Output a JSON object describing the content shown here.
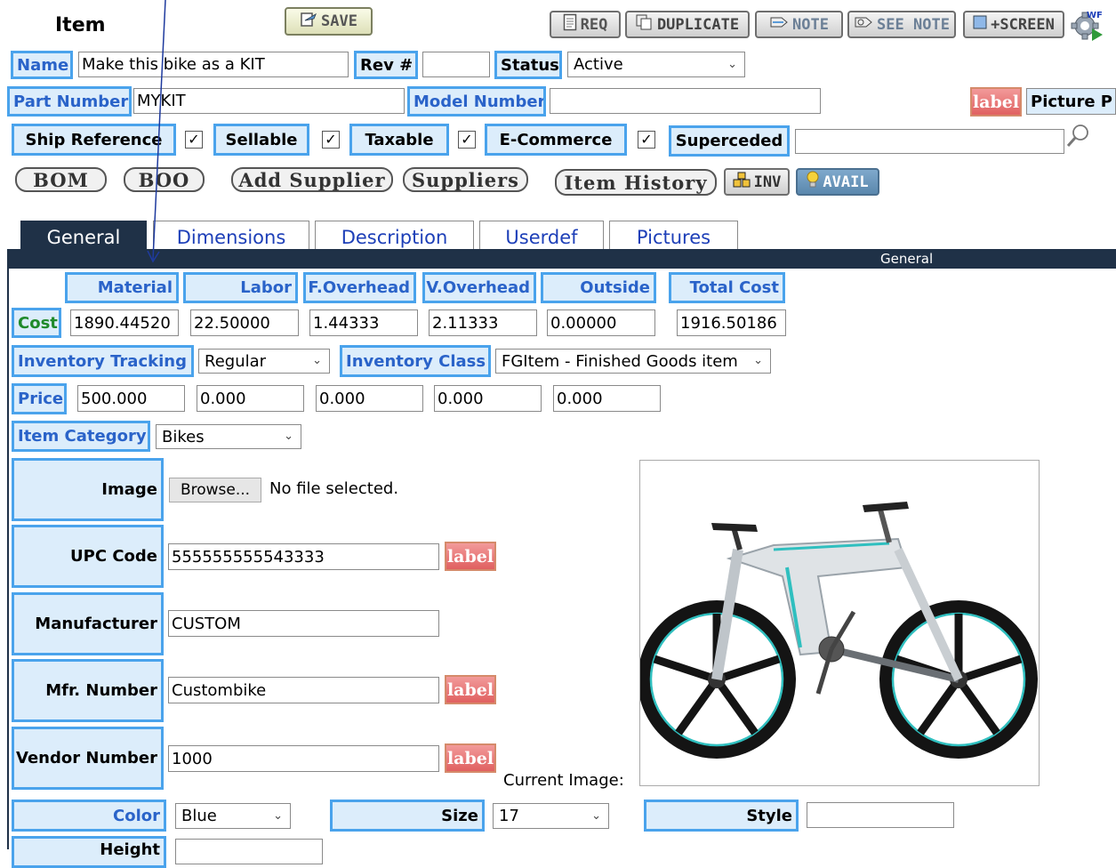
{
  "header": {
    "title": "Item",
    "save_label": "SAVE",
    "req_label": "REQ",
    "duplicate_label": "DUPLICATE",
    "note_label": "NOTE",
    "see_note_label": "SEE NOTE",
    "screen_label": "+SCREEN",
    "wf_label": "WF"
  },
  "fields": {
    "name_label": "Name",
    "name_value": "Make this bike as a KIT",
    "rev_label": "Rev #",
    "rev_value": "",
    "status_label": "Status",
    "status_value": "Active",
    "part_number_label": "Part Number",
    "part_number_value": "MYKIT",
    "model_number_label": "Model Number",
    "model_number_value": "",
    "label_badge": "label",
    "picture_label": "Picture P",
    "ship_reference_label": "Ship Reference",
    "sellable_label": "Sellable",
    "taxable_label": "Taxable",
    "ecommerce_label": "E-Commerce",
    "superceded_label": "Superceded",
    "superceded_value": "",
    "checkmark": "✓"
  },
  "buttons": {
    "bom": "BOM",
    "boo": "BOO",
    "add_supplier": "Add Supplier",
    "suppliers": "Suppliers",
    "item_history": "Item History",
    "inv": "INV",
    "avail": "AVAIL"
  },
  "tabs": [
    {
      "label": "General"
    },
    {
      "label": "Dimensions"
    },
    {
      "label": "Description"
    },
    {
      "label": "Userdef"
    },
    {
      "label": "Pictures"
    }
  ],
  "section_title": "General",
  "cost": {
    "headers": [
      "Material",
      "Labor",
      "F.Overhead",
      "V.Overhead",
      "Outside",
      "Total Cost"
    ],
    "row_label": "Cost",
    "values": [
      "1890.44520",
      "22.50000",
      "1.44333",
      "2.11333",
      "0.00000",
      "1916.50186"
    ]
  },
  "inventory": {
    "tracking_label": "Inventory Tracking",
    "tracking_value": "Regular",
    "class_label": "Inventory Class",
    "class_value": "FGItem - Finished Goods item"
  },
  "price": {
    "label": "Price",
    "values": [
      "500.000",
      "0.000",
      "0.000",
      "0.000",
      "0.000"
    ]
  },
  "category": {
    "label": "Item Category",
    "value": "Bikes"
  },
  "details": {
    "image_label": "Image",
    "browse_label": "Browse...",
    "no_file": "No file selected.",
    "upc_label": "UPC Code",
    "upc_value": "555555555543333",
    "manufacturer_label": "Manufacturer",
    "manufacturer_value": "CUSTOM",
    "mfr_number_label": "Mfr. Number",
    "mfr_number_value": "Custombike",
    "vendor_number_label": "Vendor Number",
    "vendor_number_value": "1000",
    "current_image_label": "Current Image:",
    "color_label": "Color",
    "color_value": "Blue",
    "size_label": "Size",
    "size_value": "17",
    "style_label": "Style",
    "style_value": "",
    "height_label": "Height"
  },
  "colors": {
    "label_border": "#4aa3ec",
    "label_bg": "#dcedfb",
    "tab_active_bg": "#1f3147",
    "section_bar": "#1f3147",
    "badge_red": "#e06060"
  },
  "icons": {
    "save": "save-icon",
    "req": "document-icon",
    "duplicate": "duplicate-icon",
    "note": "note-icon",
    "see_note": "see-note-icon",
    "screen": "screen-icon",
    "wf": "workflow-gear-icon",
    "search": "search-icon",
    "inv": "inventory-icon",
    "avail": "lightbulb-icon",
    "product": "bicycle-image"
  }
}
